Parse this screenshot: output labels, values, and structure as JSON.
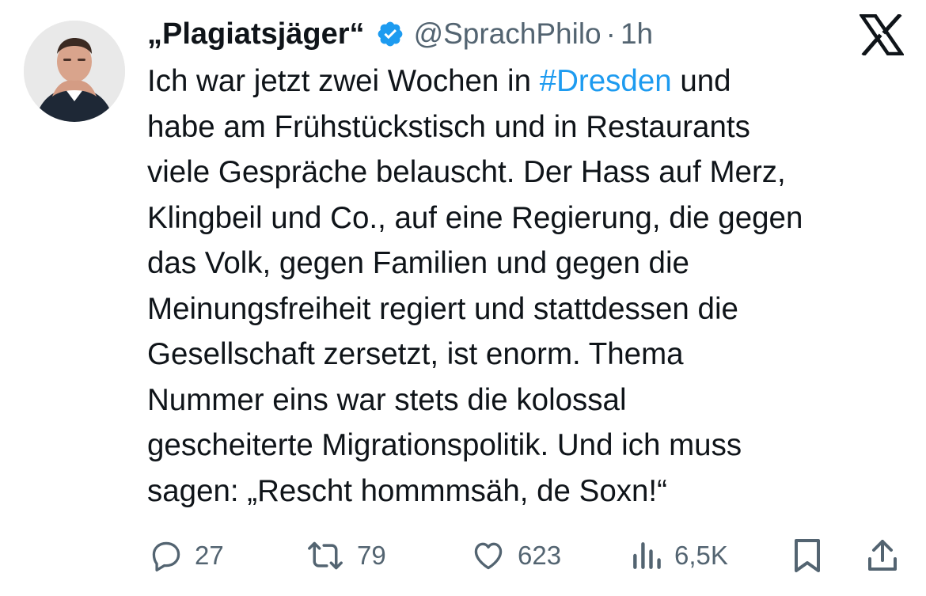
{
  "author": {
    "display_name": "„Plagiatsjäger“",
    "handle": "@SprachPhilo",
    "separator": "·",
    "time": "1h",
    "verified": true
  },
  "platform_logo": "x-logo-icon",
  "tweet": {
    "hashtag": "#Dresden",
    "lines": [
      "und",
      "habe am Frühstückstisch und in Restaurants",
      "viele Gespräche belauscht. Der Hass auf Merz,",
      "Klingbeil und Co., auf eine Regierung, die gegen",
      "das Volk, gegen Familien und gegen die",
      "Meinungsfreiheit regiert und stattdessen die",
      "Gesellschaft zersetzt, ist enorm. Thema",
      "Nummer eins war stets die kolossal",
      "gescheiterte Migrationspolitik. Und ich muss",
      "sagen: „Rescht hommmsäh, de Soxn!“"
    ],
    "first_line_prefix": "Ich war jetzt zwei Wochen in "
  },
  "actions": {
    "reply": {
      "icon": "reply-icon",
      "count": "27"
    },
    "repost": {
      "icon": "repost-icon",
      "count": "79"
    },
    "like": {
      "icon": "heart-icon",
      "count": "623"
    },
    "views": {
      "icon": "views-icon",
      "count": "6,5K"
    },
    "bookmark": {
      "icon": "bookmark-icon"
    },
    "share": {
      "icon": "share-icon"
    }
  },
  "colors": {
    "text": "#0f1419",
    "secondary": "#536471",
    "link": "#1d9bf0",
    "verified": "#1d9bf0"
  }
}
